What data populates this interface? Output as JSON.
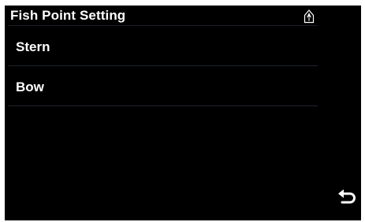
{
  "window": {
    "title": "Fish Point Setting"
  },
  "status": {
    "icon": "vessel-position-icon"
  },
  "menu": {
    "items": [
      {
        "label": "Stern"
      },
      {
        "label": "Bow"
      }
    ]
  },
  "footer": {
    "back_icon": "back-arrow-icon"
  },
  "colors": {
    "background": "#000000",
    "text": "#ffffff",
    "divider": "#1e222b"
  }
}
